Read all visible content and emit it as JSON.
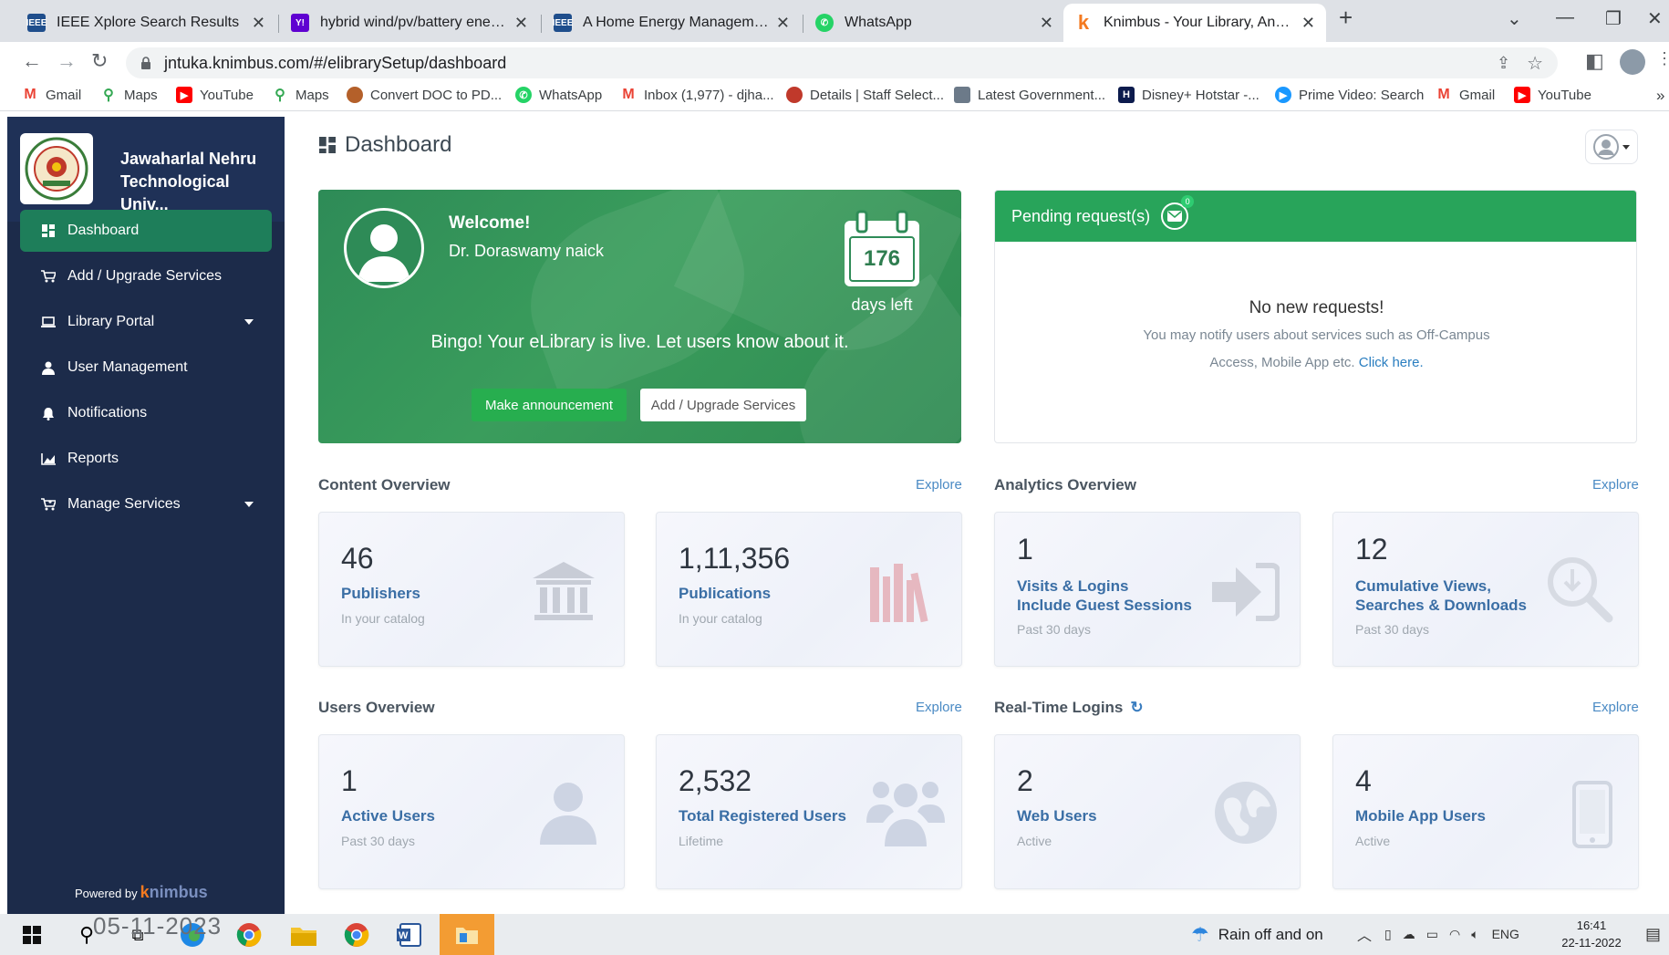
{
  "browser": {
    "tabs": [
      {
        "title": "IEEE Xplore Search Results",
        "icon": "ieee-icon"
      },
      {
        "title": "hybrid wind/pv/battery energy m",
        "icon": "yahoo-icon"
      },
      {
        "title": "A Home Energy Management Sy",
        "icon": "ieee-icon"
      },
      {
        "title": "WhatsApp",
        "icon": "whatsapp-icon"
      },
      {
        "title": "Knimbus - Your Library, Anywher",
        "icon": "knimbus-icon"
      }
    ],
    "new_tab": "+",
    "url": "jntuka.knimbus.com/#/elibrarySetup/dashboard",
    "bookmarks": [
      "Gmail",
      "Maps",
      "YouTube",
      "Maps",
      "Convert DOC to PD...",
      "WhatsApp",
      "Inbox (1,977) - djha...",
      "Details | Staff Select...",
      "Latest Government...",
      "Disney+ Hotstar -...",
      "Prime Video: Search",
      "Gmail",
      "YouTube"
    ],
    "more": "»"
  },
  "sidebar": {
    "org_name": "Jawaharlal Nehru Technological Univ...",
    "items": [
      {
        "label": "Dashboard",
        "icon": "dashboard-icon"
      },
      {
        "label": "Add / Upgrade Services",
        "icon": "cart-icon"
      },
      {
        "label": "Library Portal",
        "icon": "laptop-icon"
      },
      {
        "label": "User Management",
        "icon": "user-icon"
      },
      {
        "label": "Notifications",
        "icon": "bell-icon"
      },
      {
        "label": "Reports",
        "icon": "chart-icon"
      },
      {
        "label": "Manage Services",
        "icon": "cart-settings-icon"
      }
    ],
    "powered_by": "Powered by",
    "powered_brand_a": "k",
    "powered_brand_b": "nimbus"
  },
  "page": {
    "title": "Dashboard"
  },
  "welcome": {
    "title": "Welcome!",
    "name": "Dr. Doraswamy naick",
    "days_left_value": "176",
    "days_left_label": "days left",
    "message": "Bingo! Your eLibrary is live. Let users know about it.",
    "announce_button": "Make announcement",
    "upgrade_button": "Add / Upgrade Services"
  },
  "pending": {
    "title": "Pending request(s)",
    "count": "0",
    "empty_title": "No new requests!",
    "empty_line1": "You may notify users about services such as Off-Campus",
    "empty_line2": "Access, Mobile App etc.",
    "empty_link": "Click here."
  },
  "content_overview": {
    "title": "Content Overview",
    "explore": "Explore",
    "cards": [
      {
        "value": "46",
        "label": "Publishers",
        "sub": "In your catalog"
      },
      {
        "value": "1,11,356",
        "label": "Publications",
        "sub": "In your catalog"
      }
    ]
  },
  "analytics_overview": {
    "title": "Analytics Overview",
    "explore": "Explore",
    "cards": [
      {
        "value": "1",
        "label_line1": "Visits & Logins",
        "label_line2": "Include Guest Sessions",
        "sub": "Past 30 days"
      },
      {
        "value": "12",
        "label_line1": "Cumulative Views,",
        "label_line2": "Searches & Downloads",
        "sub": "Past 30 days"
      }
    ]
  },
  "users_overview": {
    "title": "Users Overview",
    "explore": "Explore",
    "cards": [
      {
        "value": "1",
        "label": "Active Users",
        "sub": "Past 30 days"
      },
      {
        "value": "2,532",
        "label": "Total Registered Users",
        "sub": "Lifetime"
      }
    ]
  },
  "realtime_logins": {
    "title": "Real-Time Logins",
    "explore": "Explore",
    "cards": [
      {
        "value": "2",
        "label": "Web Users",
        "sub": "Active"
      },
      {
        "value": "4",
        "label": "Mobile App Users",
        "sub": "Active"
      }
    ]
  },
  "taskbar": {
    "date_stamp": "05-11-2023",
    "weather": "Rain off and on",
    "lang": "ENG",
    "time": "16:41",
    "date": "22-11-2022"
  },
  "colors": {
    "sidebar_bg": "#1c2b4a",
    "accent_green": "#28a45a",
    "link_blue": "#3a6ea5"
  }
}
